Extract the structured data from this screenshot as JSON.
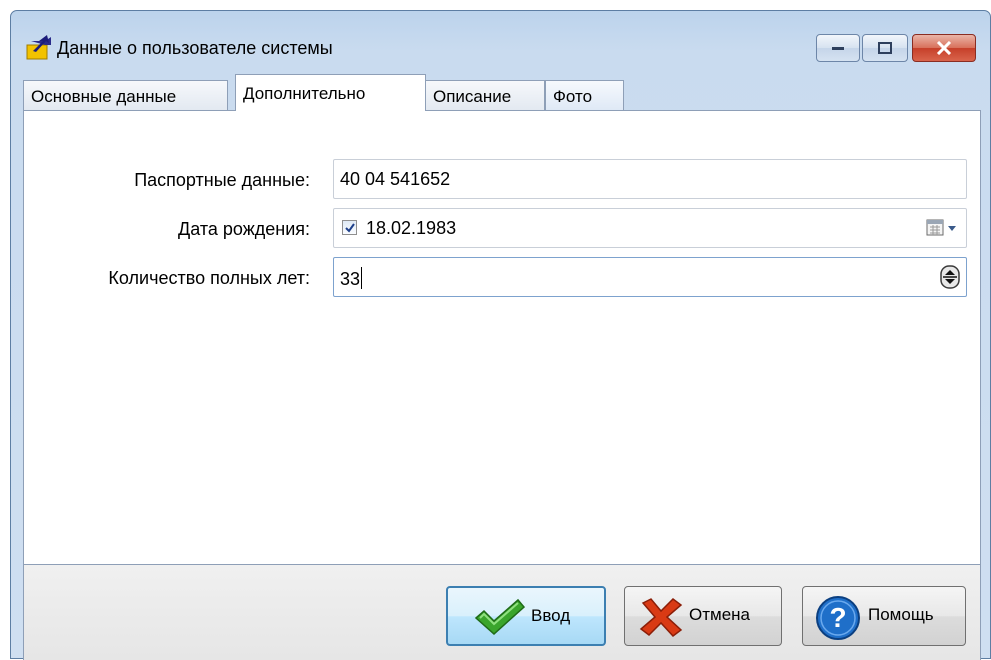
{
  "window": {
    "title": "Данные о пользователе системы",
    "icon": "folder-arrow-icon"
  },
  "tabs": [
    {
      "label": "Основные данные",
      "active": false
    },
    {
      "label": "Дополнительно",
      "active": true
    },
    {
      "label": "Описание",
      "active": false
    },
    {
      "label": "Фото",
      "active": false
    }
  ],
  "form": {
    "passport": {
      "label": "Паспортные данные:",
      "value": "40 04 541652"
    },
    "birth_date": {
      "label": "Дата рождения:",
      "value": "18.02.1983",
      "checked": true
    },
    "full_years": {
      "label": "Количество полных лет:",
      "value": "33"
    }
  },
  "buttons": {
    "ok": "Ввод",
    "cancel": "Отмена",
    "help": "Помощь"
  },
  "colors": {
    "title_bar": "#c9dbef",
    "close_button": "#c6402a",
    "ok_check": "#3aa52c",
    "cancel_x": "#d93a14",
    "help_circle": "#1f6fc9"
  }
}
